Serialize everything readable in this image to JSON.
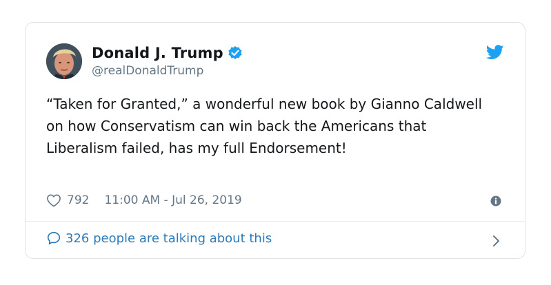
{
  "tweet": {
    "author_name": "Donald J. Trump",
    "handle": "@realDonaldTrump",
    "verified": true,
    "text": "“Taken for Granted,” a wonderful new book by Gianno Caldwell on how Conservatism can win back the Americans that Liberalism failed, has my full Endorsement!",
    "likes": "792",
    "timestamp": "11:00 AM - Jul 26, 2019",
    "conversation_text": "326 people are talking about this"
  },
  "icons": {
    "verified": "verified-badge-icon",
    "bird": "twitter-bird-icon",
    "heart": "heart-icon",
    "info": "info-icon",
    "reply": "speech-bubble-icon",
    "chevron": "chevron-right-icon"
  },
  "colors": {
    "accent": "#1da1f2",
    "link": "#2b7bb9",
    "muted": "#657786",
    "text": "#14171a",
    "border": "#dfe3e6"
  }
}
